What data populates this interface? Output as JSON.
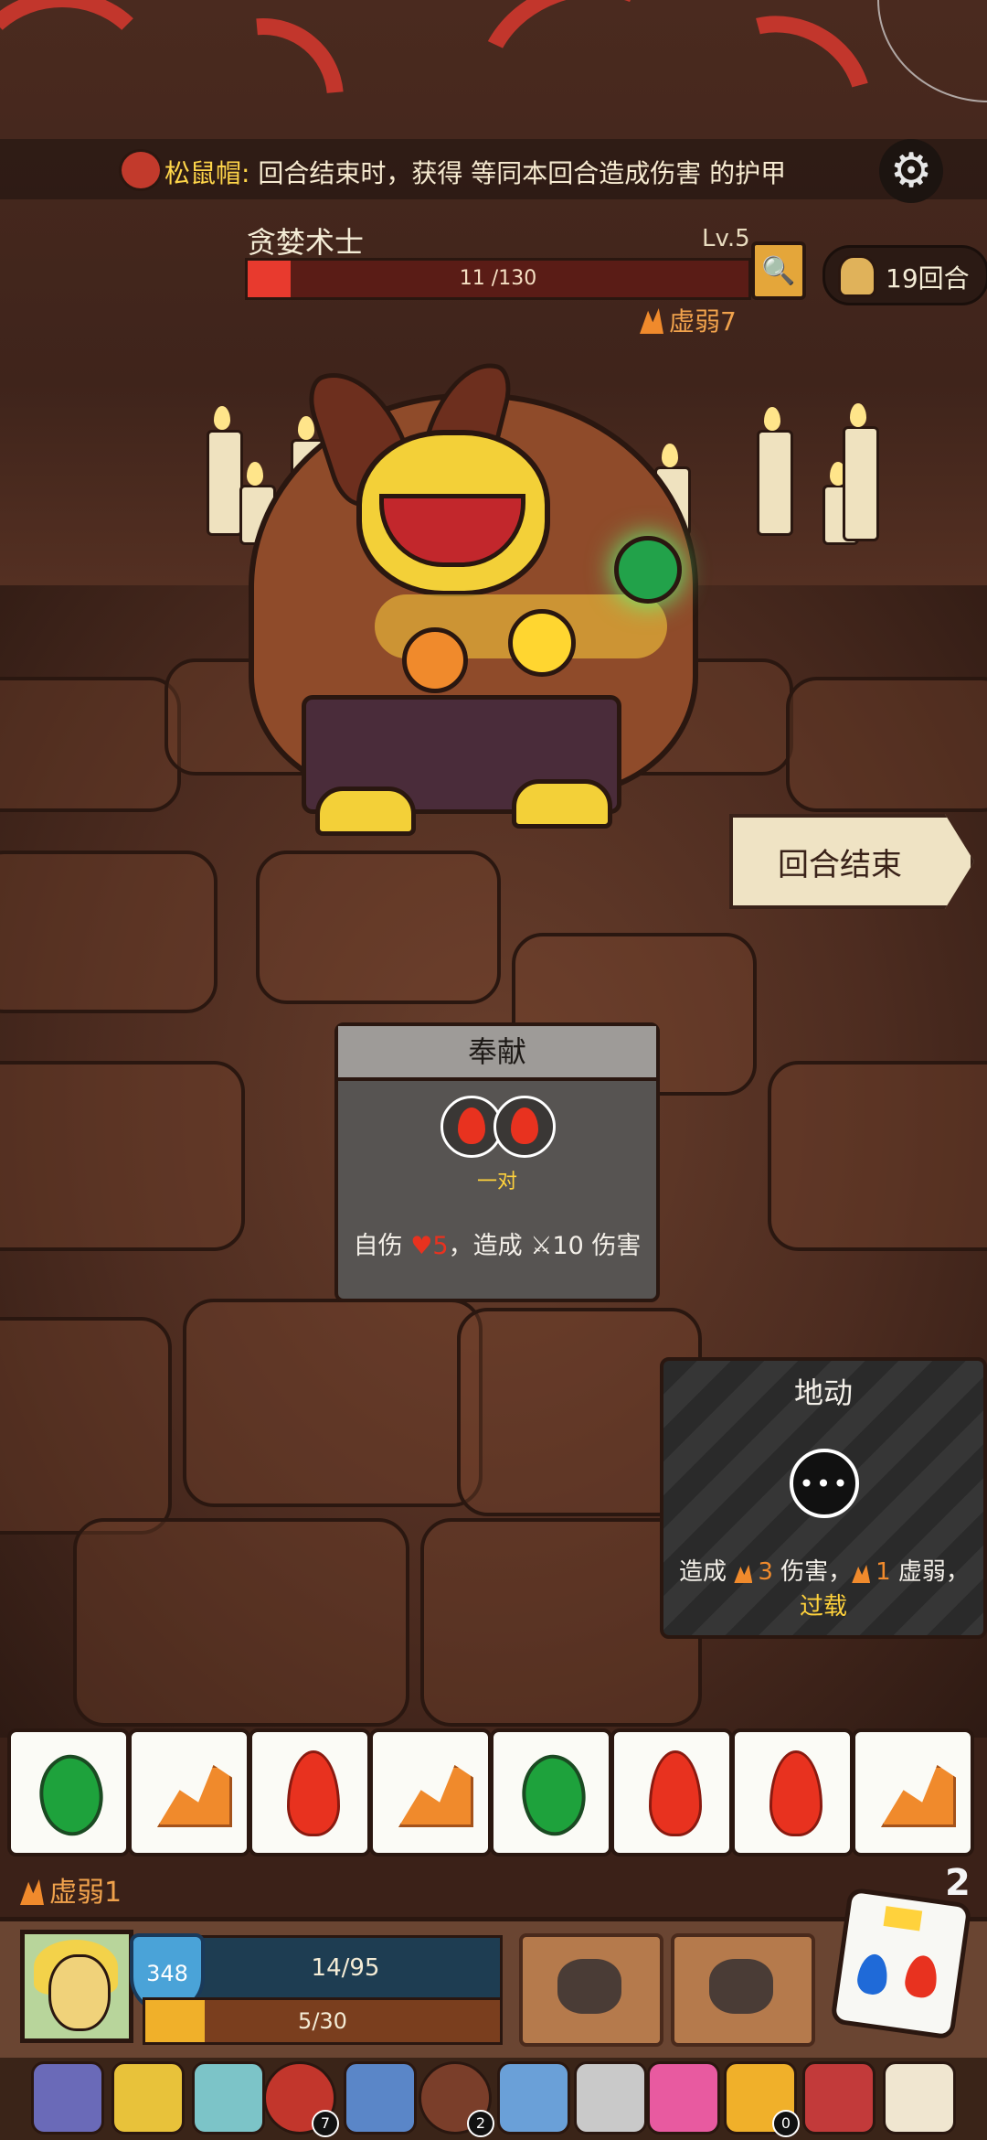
{
  "top_buff": {
    "name": "松鼠帽:",
    "text": " 回合结束时，获得 等同本回合造成伤害 的护甲"
  },
  "boss": {
    "name": "贪婪术士",
    "level": "Lv.5",
    "hp_text": "11 /130",
    "hp_fraction": 0.085,
    "weak_label": "虚弱7"
  },
  "turn_counter": "19回合",
  "end_turn_label": "回合结束",
  "card_offering": {
    "title": "奉献",
    "requirement": "一对",
    "desc_prefix": "自伤 ",
    "self_damage": "5",
    "desc_mid": "，造成 ",
    "damage": "10",
    "desc_suffix": " 伤害"
  },
  "card_quake": {
    "title": "地动",
    "dice_symbol": "•••",
    "desc_prefix": "造成 ",
    "damage": "3",
    "desc_mid": " 伤害，",
    "weak": "1",
    "desc_suffix": " 虚弱，",
    "over_label": "过载"
  },
  "dice_tray": [
    "leaf",
    "rock",
    "fire",
    "rock",
    "leaf",
    "fire",
    "fire",
    "rock"
  ],
  "player": {
    "weak_label": "虚弱1",
    "dice_count": "2",
    "armor": "348",
    "hp_text": "14/95",
    "energy_text": "5/30",
    "energy_fraction": 0.1667
  },
  "relic_badges": {
    "r4": "7",
    "r6": "2",
    "r9": "0"
  },
  "colors": {
    "boss_hp": "#e83a2e",
    "energy": "#f0b02a",
    "shield": "#4aa3d8",
    "gold_text": "#ffd23c",
    "weak_orange": "#f08a2c"
  }
}
